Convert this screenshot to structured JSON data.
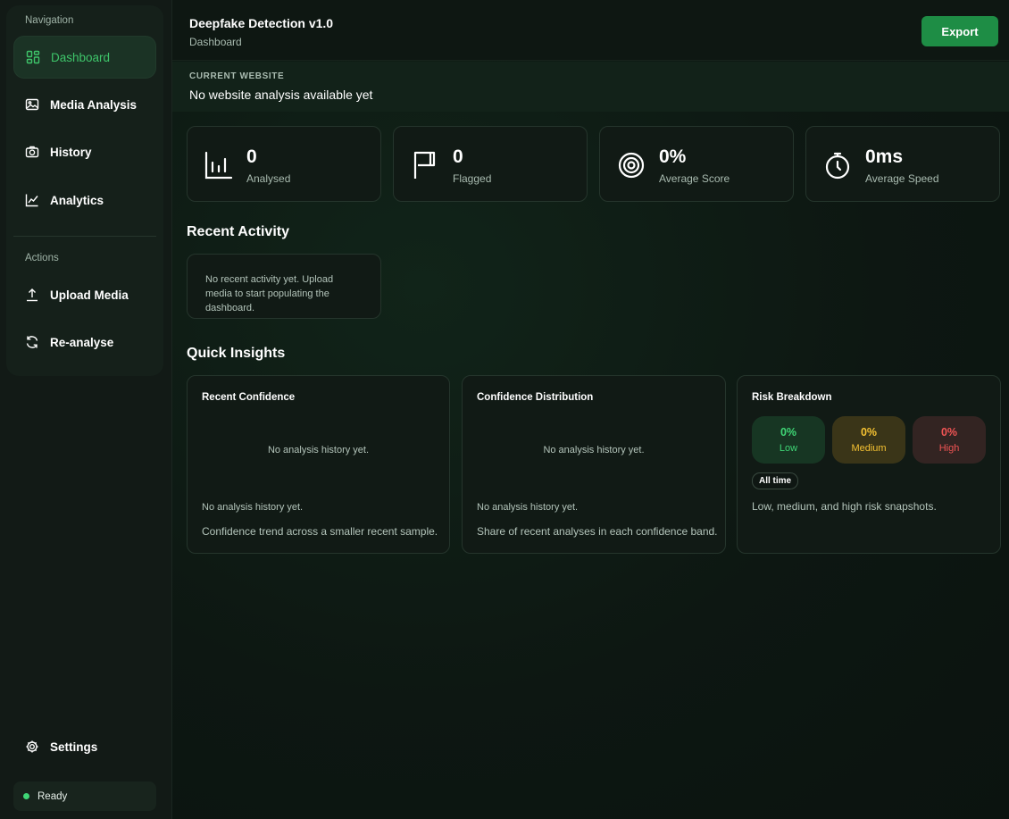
{
  "sidebar": {
    "nav_label": "Navigation",
    "nav_items": [
      {
        "label": "Dashboard",
        "icon": "dashboard-grid-icon",
        "active": true
      },
      {
        "label": "Media Analysis",
        "icon": "image-icon"
      },
      {
        "label": "History",
        "icon": "history-icon"
      },
      {
        "label": "Analytics",
        "icon": "line-chart-icon"
      }
    ],
    "actions_label": "Actions",
    "action_items": [
      {
        "label": "Upload Media",
        "icon": "upload-icon"
      },
      {
        "label": "Re-analyse",
        "icon": "refresh-icon"
      }
    ],
    "settings_label": "Settings",
    "status": "Ready"
  },
  "header": {
    "title": "Deepfake Detection v1.0",
    "breadcrumb": "Dashboard",
    "export_label": "Export"
  },
  "website": {
    "label": "CURRENT WEBSITE",
    "value": "No website analysis available yet"
  },
  "stats": [
    {
      "value": "0",
      "label": "Analysed",
      "icon": "bar-chart-icon"
    },
    {
      "value": "0",
      "label": "Flagged",
      "icon": "flag-icon"
    },
    {
      "value": "0%",
      "label": "Average Score",
      "icon": "target-icon"
    },
    {
      "value": "0ms",
      "label": "Average Speed",
      "icon": "stopwatch-icon"
    }
  ],
  "recent_activity": {
    "title": "Recent Activity",
    "empty": "No recent activity yet. Upload media to start populating the dashboard."
  },
  "quick_insights": {
    "title": "Quick Insights",
    "recent_confidence": {
      "title": "Recent Confidence",
      "empty": "No analysis history yet.",
      "note": "No analysis history yet.",
      "desc": "Confidence trend across a smaller recent sample."
    },
    "confidence_distribution": {
      "title": "Confidence Distribution",
      "empty": "No analysis history yet.",
      "note": "No analysis history yet.",
      "desc": "Share of recent analyses in each confidence band."
    },
    "risk_breakdown": {
      "title": "Risk Breakdown",
      "low": {
        "value": "0%",
        "label": "Low"
      },
      "medium": {
        "value": "0%",
        "label": "Medium"
      },
      "high": {
        "value": "0%",
        "label": "High"
      },
      "time_filter": "All time",
      "desc": "Low, medium, and high risk snapshots."
    }
  },
  "colors": {
    "accent": "#1e8d45",
    "active_text": "#3ec56a",
    "low": "#3fd676",
    "medium": "#f5c232",
    "high": "#f05454"
  }
}
